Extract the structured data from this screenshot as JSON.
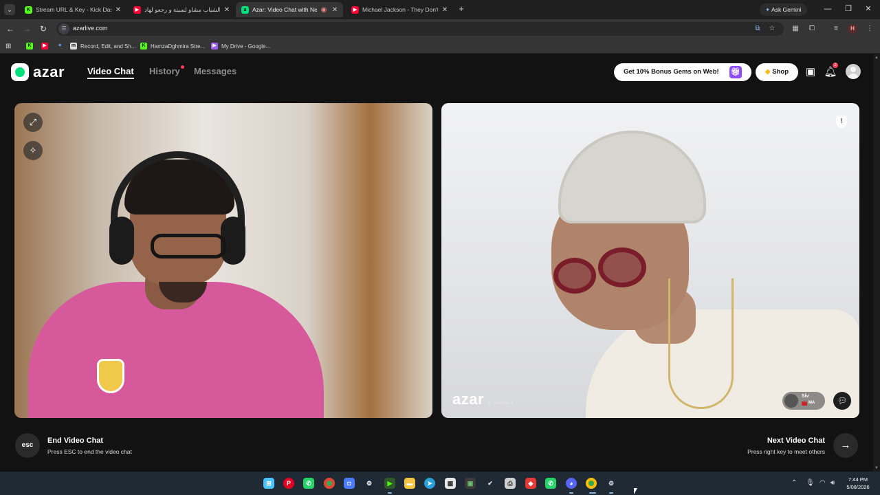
{
  "browser": {
    "tabs": [
      {
        "title": "Stream URL & Key - Kick Dashb",
        "favicon": "kick-icon",
        "color": "#53fc18"
      },
      {
        "title": "الشباب مشاو لسبتة و رجعو لهاد",
        "favicon": "youtube-icon",
        "color": "#ff0033"
      },
      {
        "title": "Azar: Video Chat with New",
        "favicon": "azar-icon",
        "color": "#00e07a",
        "active": true
      },
      {
        "title": "Michael Jackson - They Don't C",
        "favicon": "youtube-icon",
        "color": "#ff0033"
      }
    ],
    "ask_gemini": "Ask Gemini",
    "url": "azarlive.com",
    "profile_initial": "H",
    "bookmarks": [
      {
        "label": "",
        "icon": "kick-icon",
        "color": "#53fc18"
      },
      {
        "label": "",
        "icon": "youtube-icon",
        "color": "#ff0033"
      },
      {
        "label": "",
        "icon": "sparkle-icon",
        "color": "#7aa7ff"
      },
      {
        "label": "Record, Edit, and Sh...",
        "icon": "m-icon",
        "color": "#e0e0e0"
      },
      {
        "label": "HamzaDghmira Stre...",
        "icon": "kick-icon",
        "color": "#53fc18"
      },
      {
        "label": "My Drive - Google...",
        "icon": "drive-icon",
        "color": "#9c5cf5"
      }
    ]
  },
  "app": {
    "logo_text": "azar",
    "nav": {
      "video_chat": "Video Chat",
      "history": "History",
      "messages": "Messages"
    },
    "promo": "Get 10% Bonus Gems on Web!",
    "shop": "Shop",
    "notifications_count": "2",
    "watermark_text": "azar",
    "watermark_id": "V-LDdR9SC1",
    "partner": {
      "name": "Siv",
      "country": "MA"
    },
    "controls": {
      "esc_key": "esc",
      "end_title": "End Video Chat",
      "end_sub": "Press ESC to end the video chat",
      "next_title": "Next Video Chat",
      "next_sub": "Press right key to meet others"
    },
    "accent_color": "#00e07a"
  },
  "taskbar": {
    "time": "7:44 PM",
    "date": "5/08/2026"
  }
}
